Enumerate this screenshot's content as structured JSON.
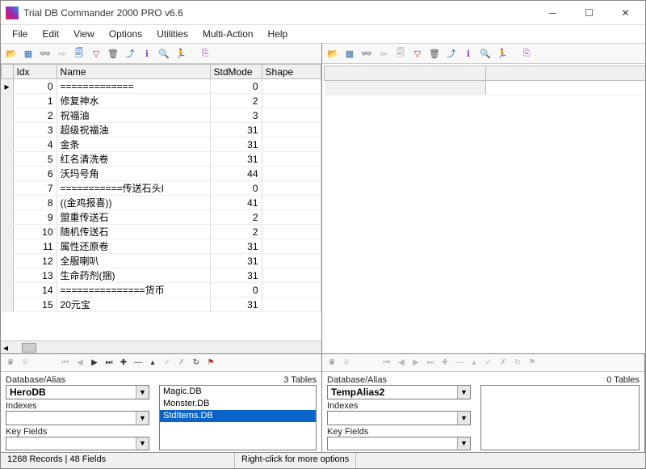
{
  "window": {
    "title": "Trial DB Commander 2000 PRO v6.6"
  },
  "menu": [
    "File",
    "Edit",
    "View",
    "Options",
    "Utilities",
    "Multi-Action",
    "Help"
  ],
  "gridLeft": {
    "cols": [
      "Idx",
      "Name",
      "StdMode",
      "Shape"
    ],
    "rows": [
      {
        "idx": "0",
        "name": "=============",
        "std": "0"
      },
      {
        "idx": "1",
        "name": "修复神水",
        "std": "2"
      },
      {
        "idx": "2",
        "name": "祝福油",
        "std": "3"
      },
      {
        "idx": "3",
        "name": "超级祝福油",
        "std": "31"
      },
      {
        "idx": "4",
        "name": "金条",
        "std": "31"
      },
      {
        "idx": "5",
        "name": "红名清洗卷",
        "std": "31"
      },
      {
        "idx": "6",
        "name": "沃玛号角",
        "std": "44"
      },
      {
        "idx": "7",
        "name": "===========传送石头I",
        "std": "0"
      },
      {
        "idx": "8",
        "name": "((金鸡报喜))",
        "std": "41"
      },
      {
        "idx": "9",
        "name": "盟重传送石",
        "std": "2"
      },
      {
        "idx": "10",
        "name": "随机传送石",
        "std": "2"
      },
      {
        "idx": "11",
        "name": "属性还原卷",
        "std": "31"
      },
      {
        "idx": "12",
        "name": "全服喇叭",
        "std": "31"
      },
      {
        "idx": "13",
        "name": "生命药剂(捆)",
        "std": "31"
      },
      {
        "idx": "14",
        "name": "===============货币",
        "std": "0"
      },
      {
        "idx": "15",
        "name": "20元宝",
        "std": "31"
      }
    ]
  },
  "left": {
    "dbLabel": "Database/Alias",
    "dbValue": "HeroDB",
    "idxLabel": "Indexes",
    "keyLabel": "Key Fields",
    "tablesLabel": "3 Tables",
    "tables": [
      "Magic.DB",
      "Monster.DB",
      "StdItems.DB"
    ],
    "tablesSel": 2
  },
  "right": {
    "dbLabel": "Database/Alias",
    "dbValue": "TempAlias2",
    "idxLabel": "Indexes",
    "keyLabel": "Key Fields",
    "tablesLabel": "0 Tables"
  },
  "status": {
    "a": "1268 Records | 48 Fields",
    "b": "Right-click for more options"
  }
}
